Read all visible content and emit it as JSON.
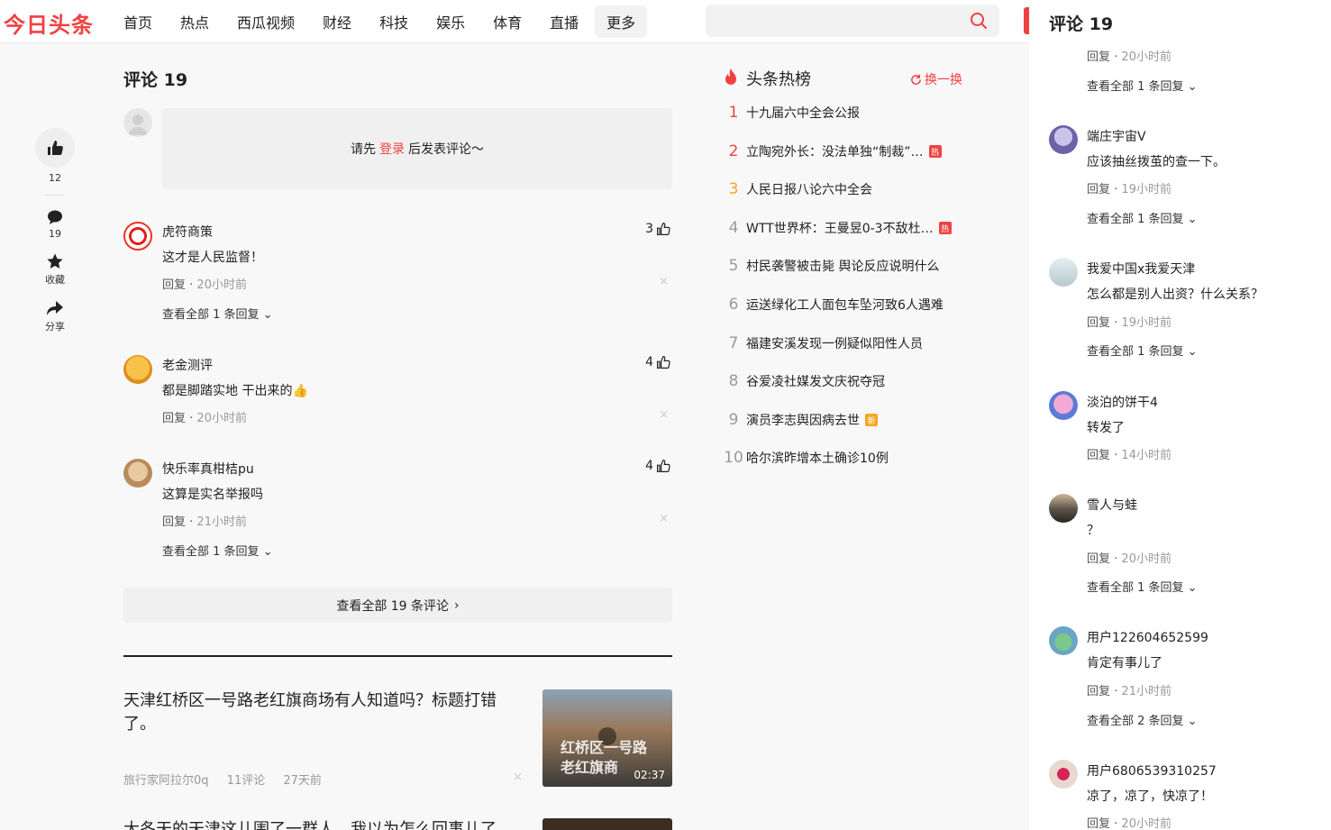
{
  "header": {
    "logo": "今日头条",
    "nav": [
      "首页",
      "热点",
      "西瓜视频",
      "财经",
      "科技",
      "娱乐",
      "体育",
      "直播",
      "更多"
    ],
    "search_placeholder": ""
  },
  "rail": {
    "like_count": "12",
    "comment_count": "19",
    "favorite_label": "收藏",
    "share_label": "分享"
  },
  "comments": {
    "title": "评论 19",
    "login_prompt_before": "请先",
    "login_link": "登录",
    "login_prompt_after": "后发表评论～",
    "reply_label": "回复",
    "close_glyph": "×",
    "items": [
      {
        "name": "虎符商策",
        "text": "这才是人民监督！",
        "time": "20小时前",
        "likes": "3",
        "more": "查看全部 1 条回复"
      },
      {
        "name": "老金测评",
        "text": "都是脚踏实地 干出来的👍",
        "time": "20小时前",
        "likes": "4",
        "more": ""
      },
      {
        "name": "快乐率真柑桔pu",
        "text": "这算是实名举报吗",
        "time": "21小时前",
        "likes": "4",
        "more": "查看全部 1 条回复"
      }
    ],
    "view_all": "查看全部 19 条评论"
  },
  "feed": [
    {
      "title": "天津红桥区一号路老红旗商场有人知道吗？标题打错了。",
      "author": "旅行家阿拉尔0q",
      "comments": "11评论",
      "time": "27天前",
      "duration": "02:37",
      "thumb_text": "红桥区一号路\n老红旗商"
    },
    {
      "title": "大冬天的天津这儿围了一群人，我以为怎么回事儿了"
    }
  ],
  "hot": {
    "title": "头条热榜",
    "refresh": "换一换",
    "tag_hot": "热",
    "tag_new": "新",
    "items": [
      {
        "rank": "1",
        "text": "十九届六中全会公报",
        "tag": ""
      },
      {
        "rank": "2",
        "text": "立陶宛外长：没法单独“制裁”…",
        "tag": "hot"
      },
      {
        "rank": "3",
        "text": "人民日报八论六中全会",
        "tag": ""
      },
      {
        "rank": "4",
        "text": "WTT世界杯：王曼昱0-3不敌杜…",
        "tag": "hot"
      },
      {
        "rank": "5",
        "text": "村民袭警被击毙 舆论反应说明什么",
        "tag": ""
      },
      {
        "rank": "6",
        "text": "运送绿化工人面包车坠河致6人遇难",
        "tag": ""
      },
      {
        "rank": "7",
        "text": "福建安溪发现一例疑似阳性人员",
        "tag": ""
      },
      {
        "rank": "8",
        "text": "谷爱凌社媒发文庆祝夺冠",
        "tag": ""
      },
      {
        "rank": "9",
        "text": "演员李志舆因病去世",
        "tag": "new"
      },
      {
        "rank": "10",
        "text": "哈尔滨昨增本土确诊10例",
        "tag": ""
      }
    ]
  },
  "panel": {
    "title": "评论 19",
    "reply_label": "回复",
    "top_partial": {
      "time": "20小时前",
      "more": "查看全部 1 条回复"
    },
    "items": [
      {
        "name": "端庄宇宙V",
        "text": "应该抽丝拨茧的查一下。",
        "time": "19小时前",
        "more": "查看全部 1 条回复"
      },
      {
        "name": "我爱中国x我爱天津",
        "text": "怎么都是别人出资？什么关系？",
        "time": "19小时前",
        "more": "查看全部 1 条回复"
      },
      {
        "name": "淡泊的饼干4",
        "text": "转发了",
        "time": "14小时前",
        "more": ""
      },
      {
        "name": "雪人与蛙",
        "text": "？",
        "time": "20小时前",
        "more": "查看全部 1 条回复"
      },
      {
        "name": "用户122604652599",
        "text": "肯定有事儿了",
        "time": "21小时前",
        "more": "查看全部 2 条回复"
      },
      {
        "name": "用户6806539310257",
        "text": "凉了，凉了，快凉了！",
        "time": "20小时前",
        "more": ""
      }
    ]
  }
}
